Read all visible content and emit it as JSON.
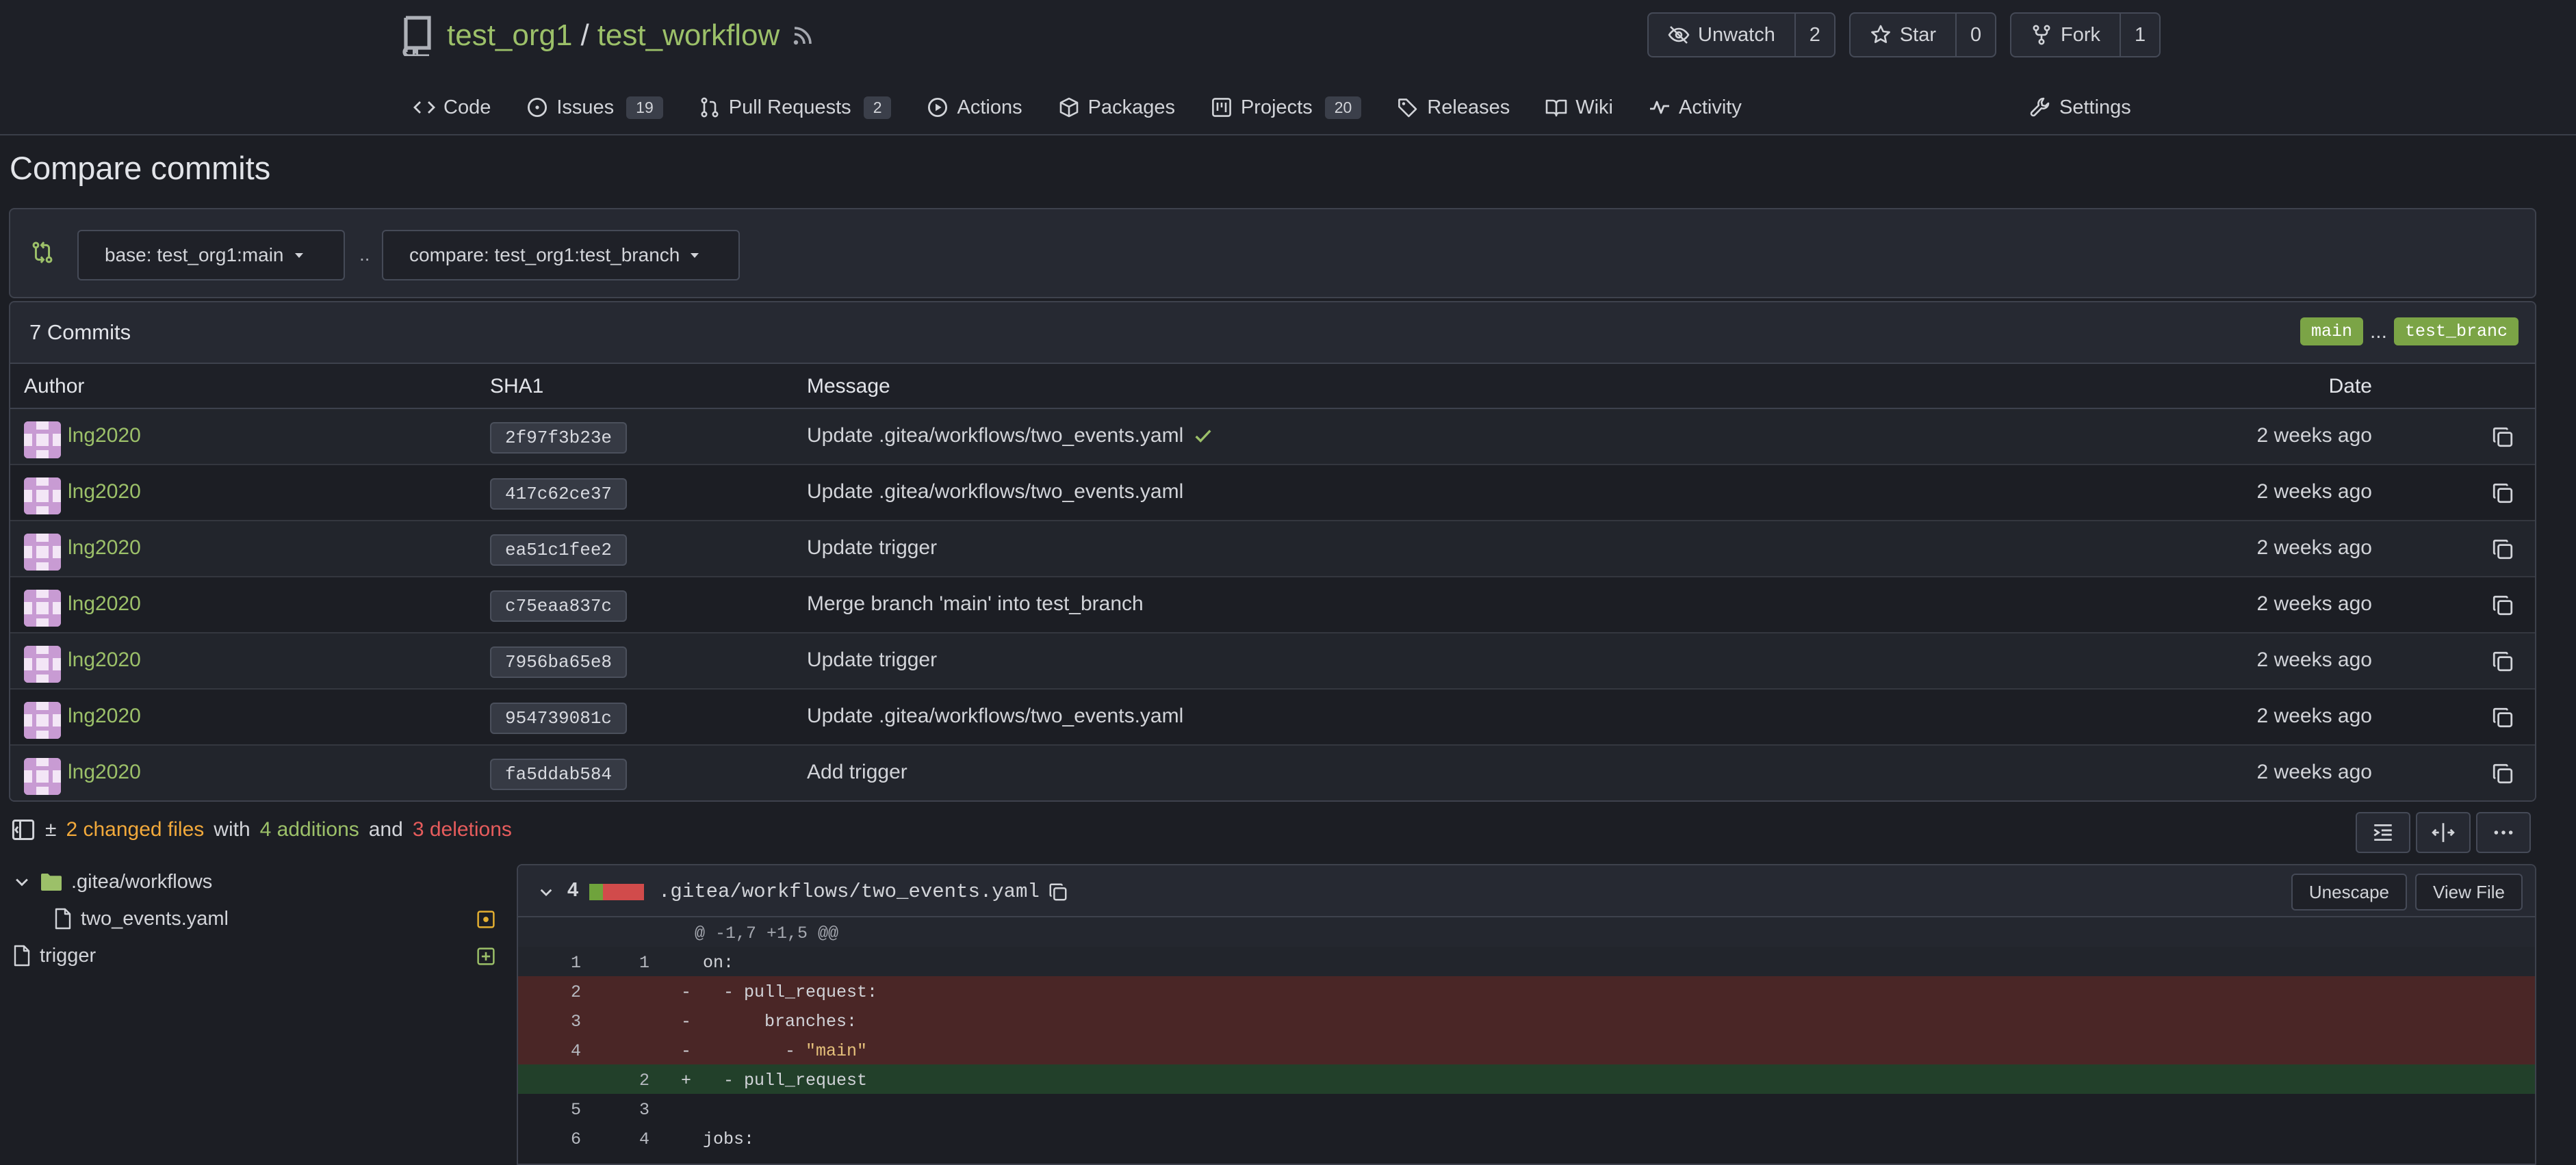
{
  "repo": {
    "owner": "test_org1",
    "separator": "/",
    "name": "test_workflow"
  },
  "header_buttons": {
    "watch": {
      "label": "Unwatch",
      "count": "2"
    },
    "star": {
      "label": "Star",
      "count": "0"
    },
    "fork": {
      "label": "Fork",
      "count": "1"
    }
  },
  "nav": {
    "code": "Code",
    "issues": {
      "label": "Issues",
      "count": "19"
    },
    "pulls": {
      "label": "Pull Requests",
      "count": "2"
    },
    "actions": "Actions",
    "packages": "Packages",
    "projects": {
      "label": "Projects",
      "count": "20"
    },
    "releases": "Releases",
    "wiki": "Wiki",
    "activity": "Activity",
    "settings": "Settings"
  },
  "page_title": "Compare commits",
  "compare": {
    "base": "base: test_org1:main",
    "dots": "..",
    "head": "compare: test_org1:test_branch"
  },
  "commits": {
    "count_label": "7 Commits",
    "base_tag": "main",
    "ellipsis": "...",
    "head_tag": "test_branc",
    "columns": {
      "author": "Author",
      "sha": "SHA1",
      "message": "Message",
      "date": "Date"
    },
    "rows": [
      {
        "author": "lng2020",
        "sha": "2f97f3b23e",
        "message": "Update .gitea/workflows/two_events.yaml",
        "date": "2 weeks ago"
      },
      {
        "author": "lng2020",
        "sha": "417c62ce37",
        "message": "Update .gitea/workflows/two_events.yaml",
        "date": "2 weeks ago"
      },
      {
        "author": "lng2020",
        "sha": "ea51c1fee2",
        "message": "Update trigger",
        "date": "2 weeks ago"
      },
      {
        "author": "lng2020",
        "sha": "c75eaa837c",
        "message": "Merge branch 'main' into test_branch",
        "date": "2 weeks ago"
      },
      {
        "author": "lng2020",
        "sha": "7956ba65e8",
        "message": "Update trigger",
        "date": "2 weeks ago"
      },
      {
        "author": "lng2020",
        "sha": "954739081c",
        "message": "Update .gitea/workflows/two_events.yaml",
        "date": "2 weeks ago"
      },
      {
        "author": "lng2020",
        "sha": "fa5ddab584",
        "message": "Add trigger",
        "date": "2 weeks ago"
      }
    ]
  },
  "diff_stats": {
    "toggle": "±",
    "changed": "2 changed files",
    "with": "with",
    "additions": "4 additions",
    "and": "and",
    "deletions": "3 deletions"
  },
  "file_tree": {
    "folder": ".gitea/workflows",
    "file1": "two_events.yaml",
    "file2": "trigger"
  },
  "diff": {
    "change_count": "4",
    "filename": ".gitea/workflows/two_events.yaml",
    "unescape": "Unescape",
    "view_file": "View File",
    "hunk": "@ -1,7 +1,5 @@",
    "lines": {
      "l1": {
        "old": "1",
        "new": "1",
        "text": "on:"
      },
      "l2": {
        "old": "2",
        "sign": "-",
        "text": "- pull_request:"
      },
      "l3": {
        "old": "3",
        "sign": "-",
        "text": "branches:"
      },
      "l4": {
        "old": "4",
        "sign": "-",
        "dash": "- ",
        "text": "\"main\""
      },
      "l5": {
        "new": "2",
        "sign": "+",
        "text": "- pull_request"
      },
      "l6": {
        "old": "5",
        "new": "3",
        "text": ""
      },
      "l7": {
        "old": "6",
        "new": "4",
        "text": "jobs:"
      }
    }
  },
  "colors": {
    "accent_green": "#9cc069",
    "tag_green": "#7ba446",
    "changed_orange": "#f2a93b",
    "deletion_red": "#e65c5c",
    "background": "#1c1e24"
  }
}
